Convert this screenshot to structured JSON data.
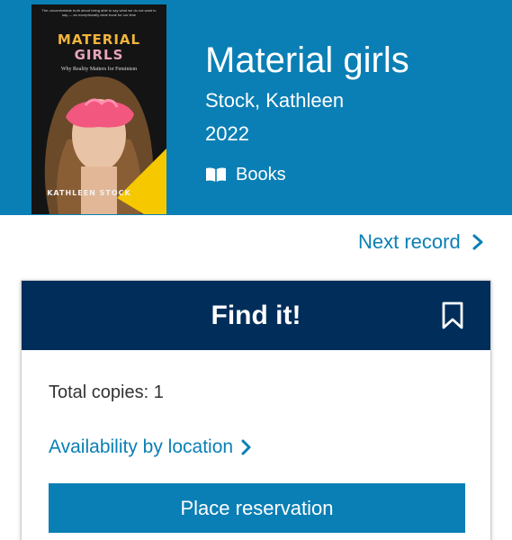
{
  "record": {
    "title": "Material girls",
    "author": "Stock, Kathleen",
    "year": "2022",
    "format": {
      "label": "Books",
      "icon": "open-book-icon"
    }
  },
  "cover": {
    "blurb": "The uncomfortable truth about being able to say what we do not want to say — an exceptionally clear book for our time",
    "title_line1": "MATERIAL",
    "title_line2": "GIRLS",
    "subtitle": "Why Reality Matters for Feminism",
    "author": "KATHLEEN STOCK"
  },
  "nav": {
    "next_label": "Next record",
    "next_icon": "chevron-right-icon"
  },
  "find_it": {
    "heading": "Find it!",
    "bookmark_icon": "bookmark-icon",
    "total_copies": "Total copies: 1",
    "availability_label": "Availability by location",
    "availability_icon": "chevron-right-icon",
    "reserve_label": "Place reservation"
  },
  "colors": {
    "brand": "#0a7fb5",
    "header_navy": "#002d5a",
    "text": "#333333",
    "white": "#ffffff"
  }
}
